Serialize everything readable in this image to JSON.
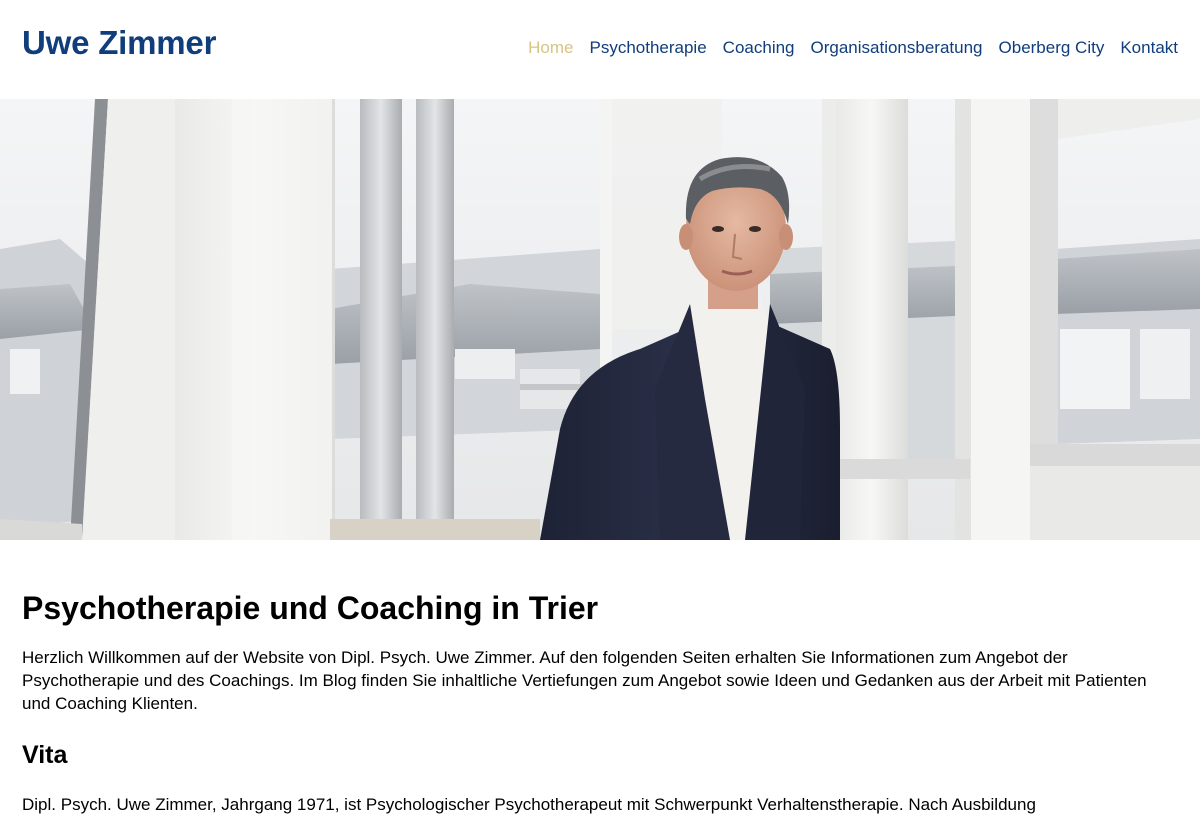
{
  "site": {
    "logo": "Uwe Zimmer"
  },
  "nav": {
    "items": [
      {
        "label": "Home",
        "active": true
      },
      {
        "label": "Psychotherapie",
        "active": false
      },
      {
        "label": "Coaching",
        "active": false
      },
      {
        "label": "Organisationsberatung",
        "active": false
      },
      {
        "label": "Oberberg City",
        "active": false
      },
      {
        "label": "Kontakt",
        "active": false
      }
    ]
  },
  "colors": {
    "brand": "#103d7c",
    "nav_active": "#d7c484",
    "text": "#000000",
    "background": "#ffffff"
  },
  "hero": {
    "image_subject": "portrait-photo"
  },
  "main": {
    "title": "Psychotherapie und Coaching in Trier",
    "intro": "Herzlich Willkommen auf der Website von Dipl. Psych. Uwe Zimmer. Auf den folgenden Seiten erhalten Sie Informationen zum Angebot der Psychotherapie und des Coachings. Im Blog finden Sie inhaltliche Vertiefungen zum Angebot sowie Ideen und Gedanken aus der Arbeit mit Patienten und Coaching Klienten.",
    "vita_heading": "Vita",
    "vita_text": "Dipl. Psych. Uwe Zimmer, Jahrgang 1971, ist Psychologischer Psychotherapeut mit Schwerpunkt Verhaltenstherapie. Nach Ausbildung"
  }
}
